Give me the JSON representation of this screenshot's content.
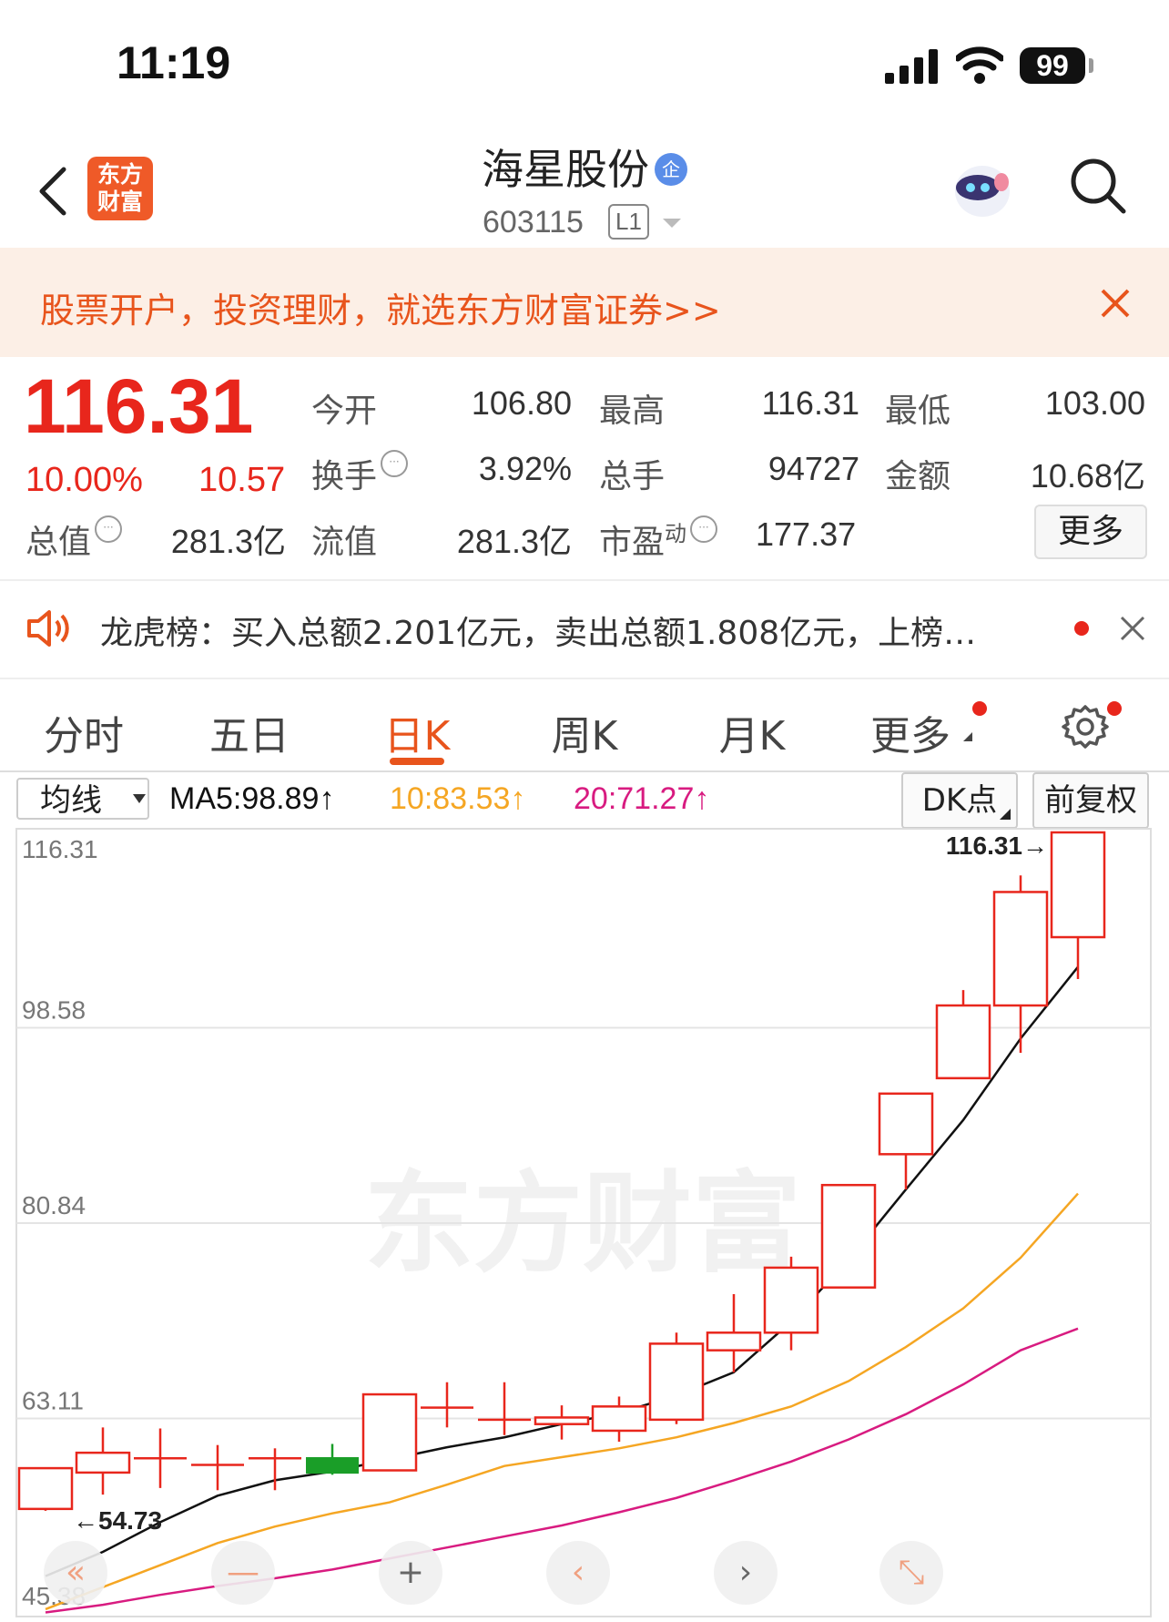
{
  "status_bar": {
    "time": "11:19",
    "battery": "99"
  },
  "header": {
    "title": "海星股份",
    "badge": "企",
    "code": "603115",
    "level": "L1",
    "logo_line1": "东方",
    "logo_line2": "财富"
  },
  "banner": {
    "text": "股票开户，投资理财，就选东方财富证券>>"
  },
  "quote": {
    "price": "116.31",
    "change_pct": "10.00%",
    "change": "10.57",
    "open_label": "今开",
    "open": "106.80",
    "high_label": "最高",
    "high": "116.31",
    "low_label": "最低",
    "low": "103.00",
    "turnover_label": "换手",
    "turnover": "3.92%",
    "volume_label": "总手",
    "volume": "94727",
    "amount_label": "金额",
    "amount": "10.68亿",
    "mktcap_label": "总值",
    "mktcap": "281.3亿",
    "float_label": "流值",
    "float_cap": "281.3亿",
    "pe_label": "市盈",
    "pe_sup": "动",
    "pe": "177.37",
    "more": "更多"
  },
  "news": {
    "text": "龙虎榜：买入总额2.201亿元，卖出总额1.808亿元，上榜…"
  },
  "tabs": [
    "分时",
    "五日",
    "日K",
    "周K",
    "月K",
    "更多"
  ],
  "ma_bar": {
    "select": "均线",
    "ma5": "MA5:98.89",
    "ma10": "10:83.53",
    "ma20": "20:71.27",
    "arrow": "↑",
    "dk": "DK点",
    "adjust": "前复权"
  },
  "colors": {
    "up": "#e8261c",
    "down": "#1a9e28",
    "ma5": "#111111",
    "ma10": "#f5a623",
    "ma20": "#d81b80",
    "accent": "#e8541c"
  },
  "chart_data": {
    "type": "candlestick",
    "y_ticks": [
      "116.31",
      "98.58",
      "80.84",
      "63.11",
      "45.38"
    ],
    "ylim": [
      45.38,
      116.31
    ],
    "max_label": "116.31→",
    "min_label": "←54.73",
    "watermark": "东方财富",
    "candles": [
      {
        "o": 54.9,
        "c": 58.6,
        "h": 58.6,
        "l": 54.73
      },
      {
        "o": 58.2,
        "c": 60.0,
        "h": 62.3,
        "l": 56.2
      },
      {
        "o": 59.6,
        "c": 59.6,
        "h": 62.2,
        "l": 56.8
      },
      {
        "o": 59.0,
        "c": 59.0,
        "h": 60.7,
        "l": 56.6
      },
      {
        "o": 59.6,
        "c": 59.6,
        "h": 60.4,
        "l": 56.6
      },
      {
        "o": 59.6,
        "c": 58.1,
        "h": 60.8,
        "l": 58.0
      },
      {
        "o": 58.4,
        "c": 65.3,
        "h": 65.3,
        "l": 58.4
      },
      {
        "o": 64.2,
        "c": 64.2,
        "h": 66.4,
        "l": 62.3
      },
      {
        "o": 63.1,
        "c": 63.1,
        "h": 66.4,
        "l": 61.6
      },
      {
        "o": 62.6,
        "c": 63.2,
        "h": 64.3,
        "l": 61.2
      },
      {
        "o": 62.0,
        "c": 64.2,
        "h": 65.1,
        "l": 61.0
      },
      {
        "o": 63.0,
        "c": 69.9,
        "h": 70.9,
        "l": 62.6
      },
      {
        "o": 69.3,
        "c": 70.9,
        "h": 74.4,
        "l": 67.3
      },
      {
        "o": 70.9,
        "c": 76.8,
        "h": 77.8,
        "l": 69.3
      },
      {
        "o": 75.0,
        "c": 84.3,
        "h": 84.3,
        "l": 75.0
      },
      {
        "o": 87.1,
        "c": 92.6,
        "h": 92.6,
        "l": 83.9
      },
      {
        "o": 94.0,
        "c": 100.6,
        "h": 102.0,
        "l": 94.0
      },
      {
        "o": 100.6,
        "c": 110.9,
        "h": 112.4,
        "l": 96.3
      },
      {
        "o": 106.8,
        "c": 116.31,
        "h": 116.31,
        "l": 103.0
      }
    ],
    "ma5": [
      48.8,
      51.0,
      53.7,
      56.1,
      57.5,
      58.3,
      59.4,
      60.5,
      61.4,
      62.6,
      63.6,
      65.2,
      67.3,
      71.9,
      77.5,
      83.9,
      90.2,
      97.6,
      104.1
    ],
    "ma10": [
      45.8,
      47.8,
      49.8,
      51.8,
      53.3,
      54.5,
      55.5,
      57.1,
      58.8,
      59.6,
      60.4,
      61.4,
      62.7,
      64.2,
      66.5,
      69.6,
      73.1,
      77.7,
      83.53
    ],
    "ma20": [
      45.5,
      46.2,
      47.1,
      47.9,
      48.6,
      49.4,
      50.4,
      51.4,
      52.4,
      53.4,
      54.6,
      55.9,
      57.5,
      59.2,
      61.2,
      63.5,
      66.2,
      69.3,
      71.27
    ]
  }
}
